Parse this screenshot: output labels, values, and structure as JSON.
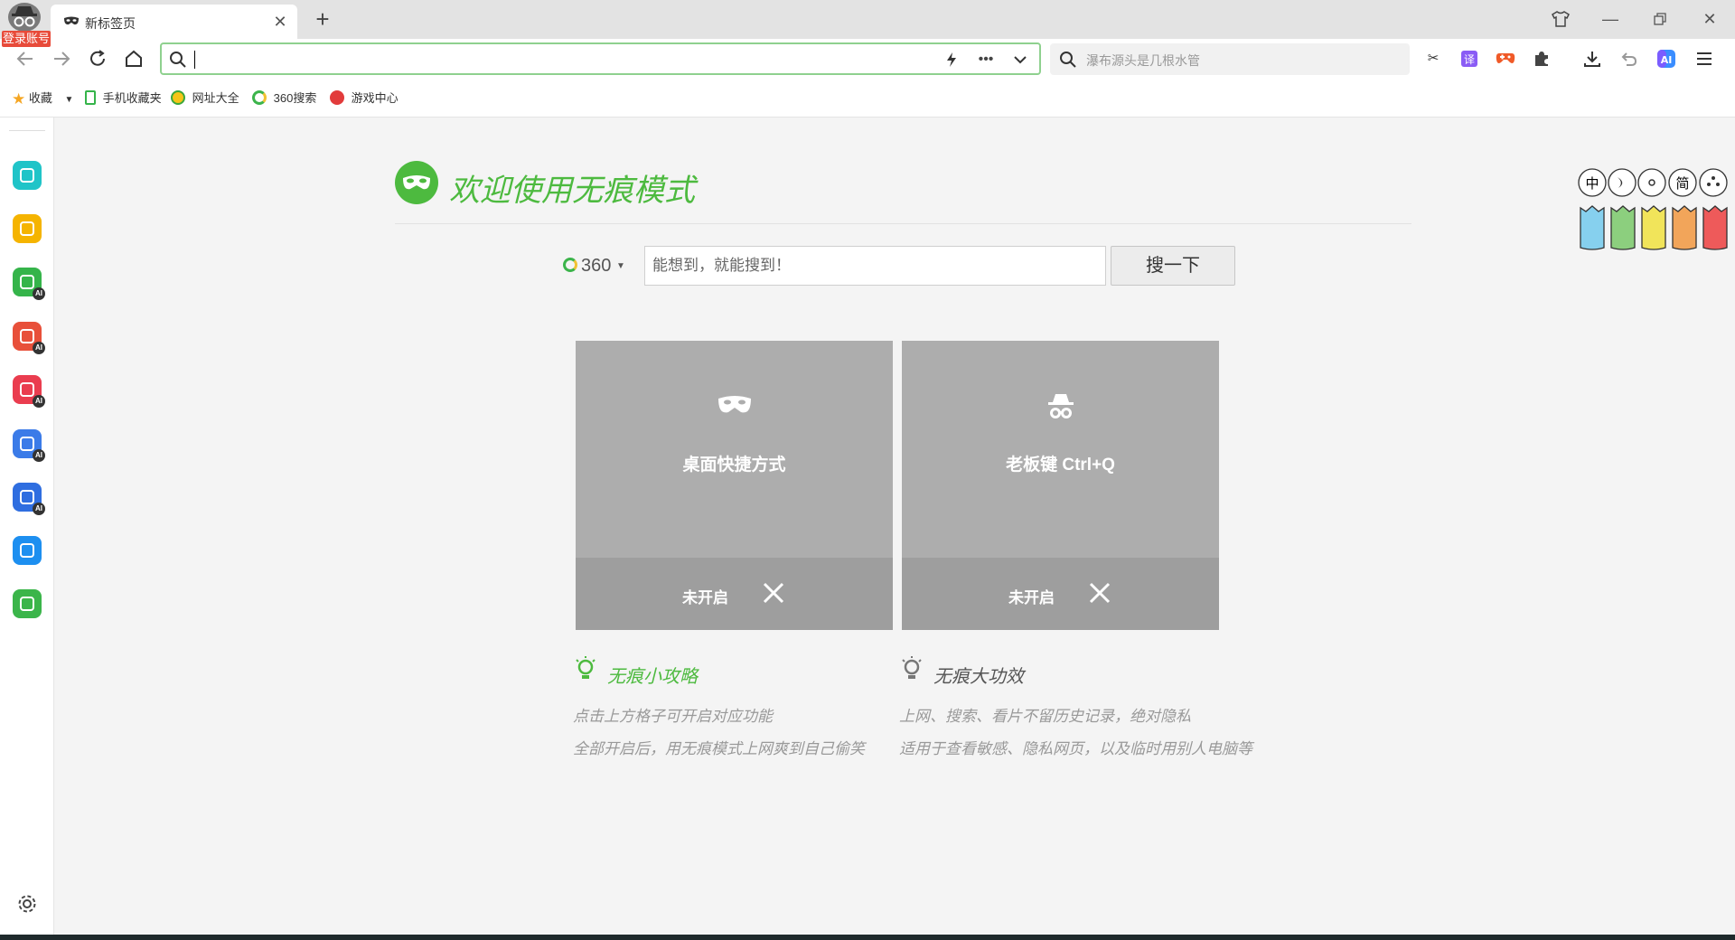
{
  "browser": {
    "account_label": "登录账号",
    "tab": {
      "title": "新标签页"
    },
    "search_placeholder": "瀑布源头是几根水管"
  },
  "bookmarks": [
    {
      "label": "收藏",
      "icon": "star-icon"
    },
    {
      "label": "手机收藏夹",
      "icon": "phone-icon"
    },
    {
      "label": "网址大全",
      "icon": "globe-icon"
    },
    {
      "label": "360搜索",
      "icon": "search-360-icon"
    },
    {
      "label": "游戏中心",
      "icon": "game-center-icon"
    }
  ],
  "sidebar": {
    "items": [
      {
        "name": "sidebar-item-apps",
        "icon": "apps-icon",
        "color": "#20c4c8",
        "ai": false
      },
      {
        "name": "sidebar-item-favorites",
        "icon": "star-icon",
        "color": "#f5b400",
        "ai": false
      },
      {
        "name": "sidebar-item-ai-image",
        "icon": "image-icon",
        "color": "#35b44a",
        "ai": true
      },
      {
        "name": "sidebar-item-ai-pdf",
        "icon": "pdf-icon",
        "color": "#e8503a",
        "ai": true
      },
      {
        "name": "sidebar-item-ai-video",
        "icon": "video-icon",
        "color": "#ea3d4f",
        "ai": true
      },
      {
        "name": "sidebar-item-ai-write",
        "icon": "write-icon",
        "color": "#3b7be8",
        "ai": true
      },
      {
        "name": "sidebar-item-ai-doc",
        "icon": "document-icon",
        "color": "#2f6ee0",
        "ai": true
      },
      {
        "name": "sidebar-item-translate",
        "icon": "translate-icon",
        "color": "#1d8ff0",
        "ai": false
      },
      {
        "name": "sidebar-item-screenshot",
        "icon": "scissors-icon",
        "color": "#3bb54a",
        "ai": false
      }
    ]
  },
  "main": {
    "welcome_title": "欢迎使用无痕模式",
    "search": {
      "engine_label": "360",
      "placeholder": "能想到，就能搜到！",
      "button_label": "搜一下"
    },
    "cards": [
      {
        "label": "桌面快捷方式",
        "status": "未开启",
        "icon": "mask-icon"
      },
      {
        "label": "老板键 Ctrl+Q",
        "status": "未开启",
        "icon": "incognito-icon"
      }
    ],
    "tips": [
      {
        "title": "无痕小攻略",
        "color": "#4dba3f",
        "lines": [
          "点击上方格子可开启对应功能",
          "全部开启后，用无痕模式上网爽到自己偷笑"
        ]
      },
      {
        "title": "无痕大功效",
        "color": "#555555",
        "lines": [
          "上网、搜索、看片不留历史记录，绝对隐私",
          "适用于查看敏感、隐私网页，以及临时用别人电脑等"
        ]
      }
    ],
    "mascot_labels": [
      "中",
      "简"
    ]
  }
}
